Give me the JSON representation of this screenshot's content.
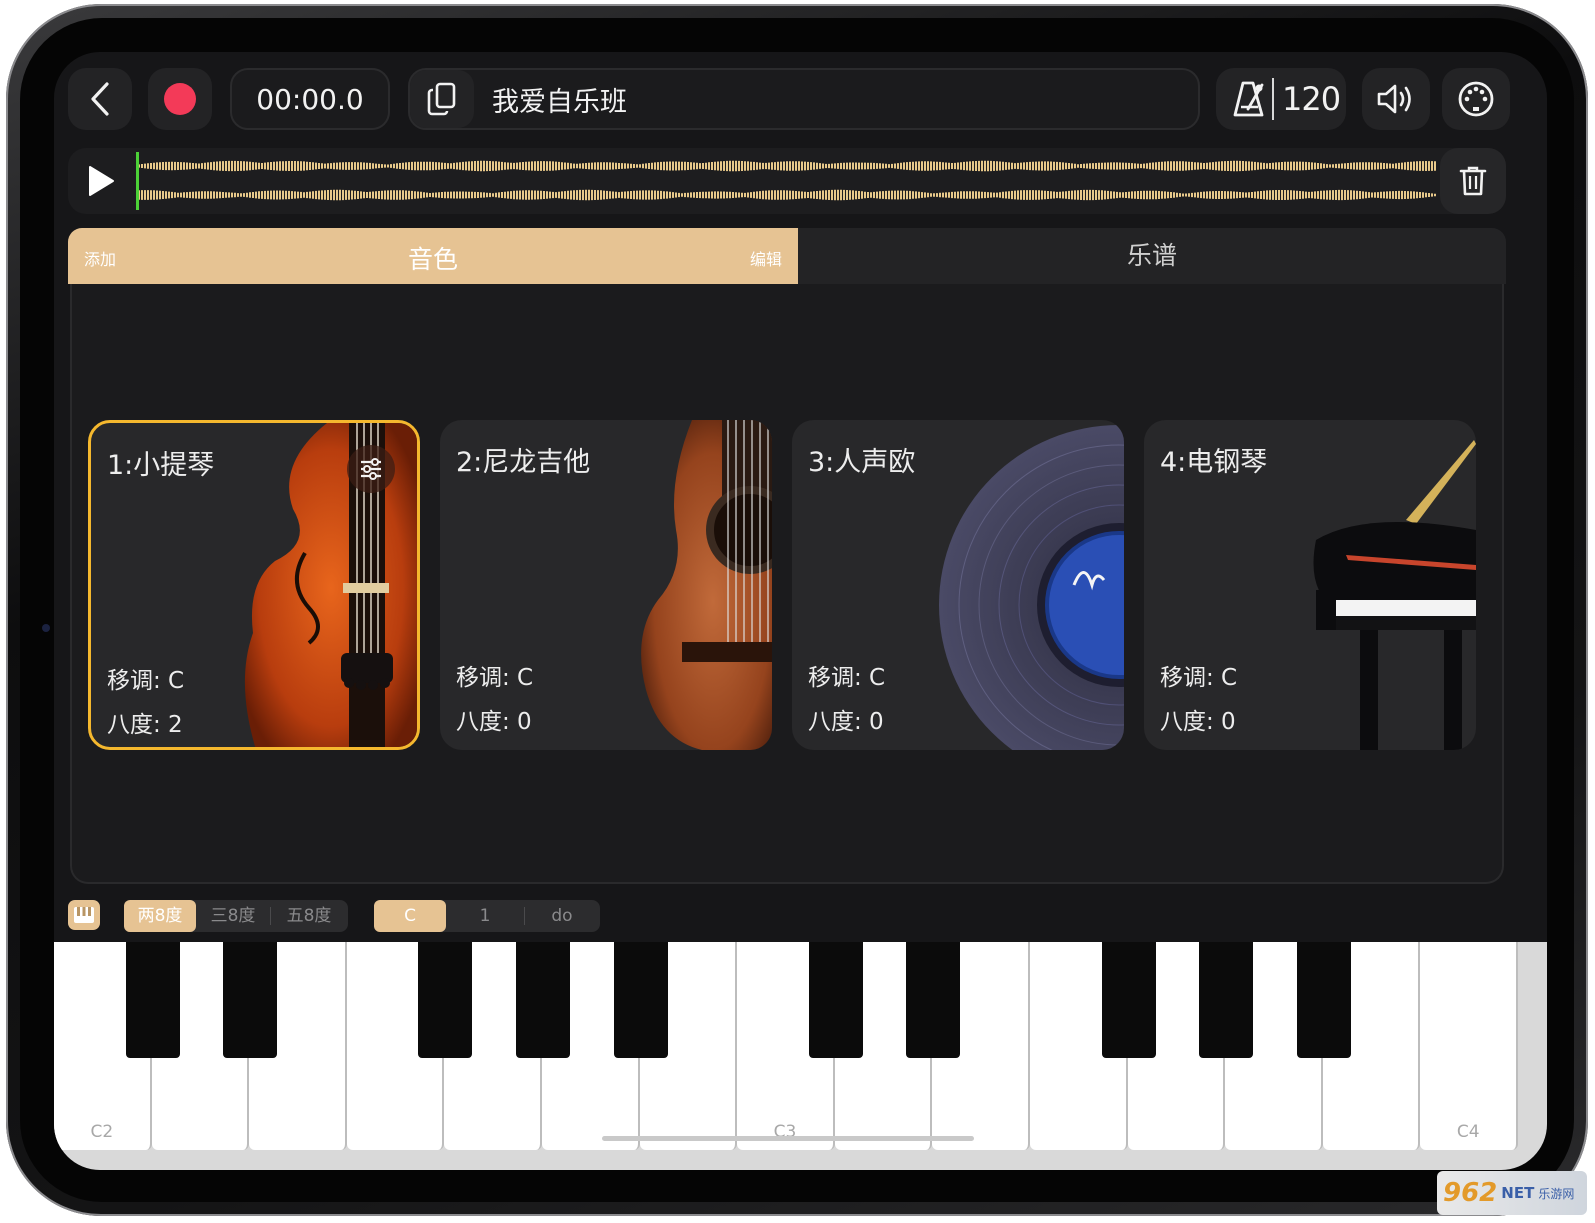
{
  "header": {
    "timer": "00:00.0",
    "project_title": "我爱自乐班",
    "tempo": "120"
  },
  "tabs": {
    "add": "添加",
    "tone": "音色",
    "edit": "编辑",
    "score": "乐谱"
  },
  "instruments": [
    {
      "name": "1:小提琴",
      "transpose": "移调: C",
      "octave": "八度: 2",
      "selected": true
    },
    {
      "name": "2:尼龙吉他",
      "transpose": "移调: C",
      "octave": "八度: 0",
      "selected": false
    },
    {
      "name": "3:人声欧",
      "transpose": "移调: C",
      "octave": "八度: 0",
      "selected": false
    },
    {
      "name": "4:电钢琴",
      "transpose": "移调: C",
      "octave": "八度: 0",
      "selected": false
    }
  ],
  "range_options": [
    "两8度",
    "三8度",
    "五8度"
  ],
  "range_selected": "两8度",
  "notation_options": [
    "C",
    "1",
    "do"
  ],
  "notation_selected": "C",
  "key_labels": {
    "c2": "C2",
    "c3": "C3",
    "c4": "C4"
  },
  "watermark": {
    "brand": "962",
    "suffix": "NET",
    "sub": "乐游网"
  },
  "colors": {
    "accent": "#e6c393",
    "record": "#f33a58",
    "selected_border": "#f5b82e",
    "waveform": "#e8c98a",
    "playhead": "#4cd137"
  }
}
